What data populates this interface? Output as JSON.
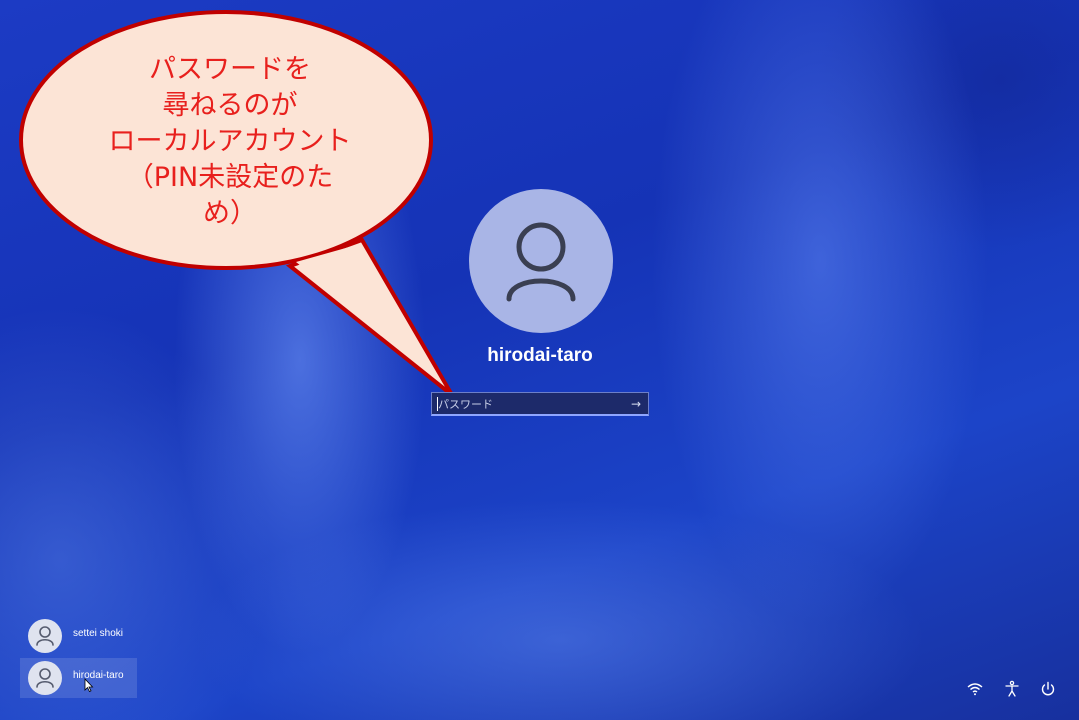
{
  "callout": {
    "lines": [
      "パスワードを",
      "尋ねるのが",
      "ローカルアカウント",
      "（PIN未設定のた",
      "め）"
    ]
  },
  "login": {
    "username": "hirodai-taro",
    "password_placeholder": "パスワード",
    "submit_icon": "arrow-right-icon"
  },
  "user_list": [
    {
      "name": "settei shoki",
      "selected": false
    },
    {
      "name": "hirodai-taro",
      "selected": true
    }
  ],
  "tray": {
    "icons": [
      "wifi-icon",
      "accessibility-icon",
      "power-icon"
    ]
  },
  "colors": {
    "callout_fill": "#fce4d6",
    "callout_border": "#c00000",
    "callout_text": "#e8201d",
    "avatar_bg": "#a9b5e6"
  }
}
